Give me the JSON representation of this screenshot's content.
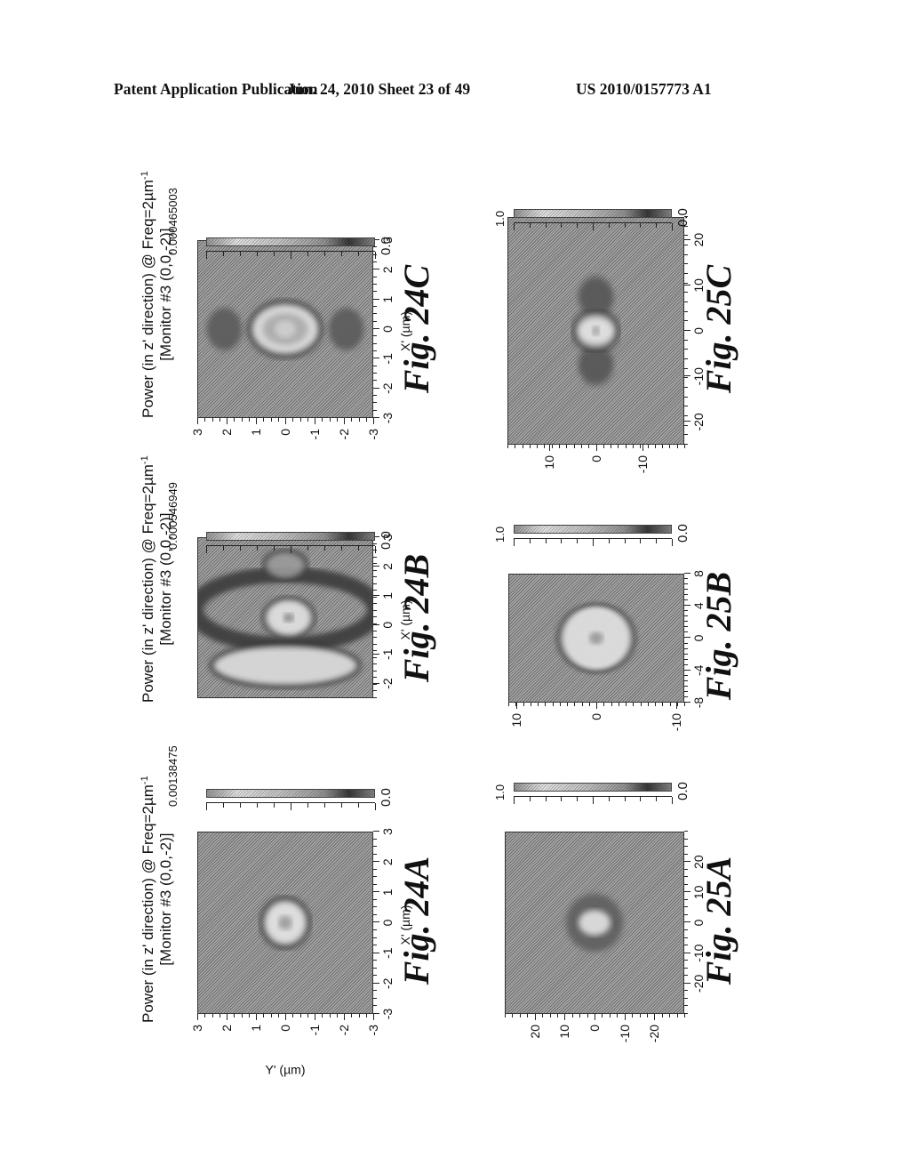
{
  "header": {
    "left": "Patent Application Publication",
    "middle": "Jun. 24, 2010  Sheet 23 of 49",
    "right": "US 2010/0157773 A1"
  },
  "chart_data": [
    {
      "type": "heatmap",
      "figure": "Fig. 24A",
      "title_line1": "Power (in z' direction) @ Freq=2µm",
      "title_sup": "-1",
      "title_line2": "[Monitor #3 (0,0,-2)]",
      "xlabel": "X' (µm)",
      "ylabel": "Y' (µm)",
      "xlim": [
        -3,
        3
      ],
      "ylim": [
        -3,
        3
      ],
      "xticks": [
        "-3",
        "-2",
        "-1",
        "0",
        "1",
        "2",
        "3"
      ],
      "yticks": [
        "3",
        "2",
        "1",
        "0",
        "-1",
        "-2",
        "-3"
      ],
      "colorbar": {
        "max": "0.00138475",
        "min": "0.0"
      },
      "features": "single bright circular spot centered at origin, radius ~0.8 µm, dark ring around it"
    },
    {
      "type": "heatmap",
      "figure": "Fig. 24B",
      "title_line1": "Power (in z' direction) @ Freq=2µm",
      "title_sup": "-1",
      "title_line2": "[Monitor #3 (0,0,-2)]",
      "xlabel": "X' (µm)",
      "ylabel": "",
      "xlim": [
        -2.5,
        3
      ],
      "ylim": [
        -3,
        3
      ],
      "xticks": [
        "-2",
        "-1",
        "0",
        "1",
        "2",
        "3"
      ],
      "yticks": [],
      "colorbar": {
        "max": "0.000546949",
        "min": "0.0"
      },
      "features": "bright spot at origin, dimmer lobe near x=2, bright crescent band near x=-1.5"
    },
    {
      "type": "heatmap",
      "figure": "Fig. 24C",
      "title_line1": "Power (in z' direction) @ Freq=2µm",
      "title_sup": "-1",
      "title_line2": "[Monitor #3 (0,0,-2)]",
      "xlabel": "X' (µm)",
      "ylabel": "",
      "xlim": [
        -3,
        3
      ],
      "ylim": [
        -3,
        3
      ],
      "xticks": [
        "-3",
        "-2",
        "-1",
        "0",
        "1",
        "2",
        "3"
      ],
      "yticks": [
        "3",
        "2",
        "1",
        "0",
        "-1",
        "-2",
        "-3"
      ],
      "colorbar": {
        "max": "0.000465003",
        "min": "0.0"
      },
      "features": "bright elliptical ring at origin elongated along Y, dark lobes at y=±2.5"
    },
    {
      "type": "heatmap",
      "figure": "Fig. 25A",
      "xlim": [
        -30,
        30
      ],
      "ylim": [
        -30,
        30
      ],
      "xticks": [
        "-20",
        "-10",
        "0",
        "10",
        "20"
      ],
      "yticks": [
        "20",
        "10",
        "0",
        "-10",
        "-20"
      ],
      "colorbar": {
        "max": "1.0",
        "min": "0.0"
      },
      "features": "small bright spot at origin with dark surround"
    },
    {
      "type": "heatmap",
      "figure": "Fig. 25B",
      "xlim": [
        -8,
        8
      ],
      "ylim": [
        -11,
        11
      ],
      "xticks": [
        "-8",
        "-4",
        "0",
        "4",
        "8"
      ],
      "yticks": [
        "10",
        "0",
        "-10"
      ],
      "colorbar": {
        "max": "1.0",
        "min": "0.0"
      },
      "features": "bright circular spot at origin, radius ~3 µm"
    },
    {
      "type": "heatmap",
      "figure": "Fig. 25C",
      "xlim": [
        -25,
        25
      ],
      "ylim": [
        -19,
        19
      ],
      "xticks": [
        "-20",
        "-10",
        "0",
        "10",
        "20"
      ],
      "yticks": [
        "10",
        "0",
        "-10"
      ],
      "colorbar": {
        "max": "1.0",
        "min": "0.0"
      },
      "features": "small bright elliptical spot at origin with dark lobes along X"
    }
  ]
}
